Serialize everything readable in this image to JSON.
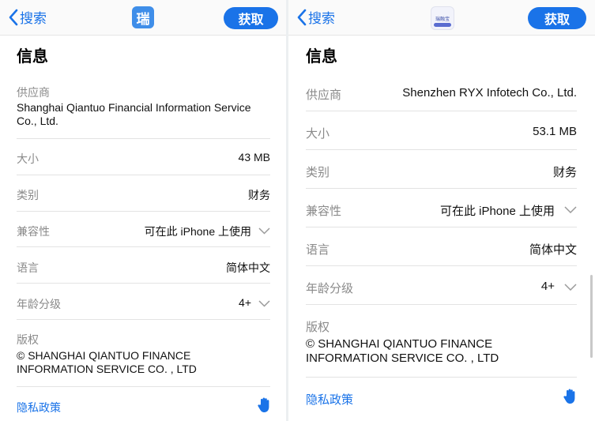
{
  "left": {
    "nav": {
      "back_label": "搜索",
      "icon_char": "瑞",
      "get_label": "获取"
    },
    "section_title": "信息",
    "vendor": {
      "label": "供应商",
      "value": "Shanghai Qiantuo Financial Information Service Co., Ltd."
    },
    "size": {
      "label": "大小",
      "value": "43 MB"
    },
    "category": {
      "label": "类别",
      "value": "财务"
    },
    "compatibility": {
      "label": "兼容性",
      "value": "可在此 iPhone 上使用"
    },
    "language": {
      "label": "语言",
      "value": "简体中文"
    },
    "age": {
      "label": "年龄分级",
      "value": "4+"
    },
    "copyright": {
      "label": "版权",
      "value": "© SHANGHAI QIANTUO FINANCE INFORMATION SERVICE CO. , LTD"
    },
    "privacy": {
      "label": "隐私政策"
    }
  },
  "right": {
    "nav": {
      "back_label": "搜索",
      "icon_text": "瑞融宝",
      "get_label": "获取"
    },
    "section_title": "信息",
    "vendor": {
      "label": "供应商",
      "value": "Shenzhen RYX Infotech Co., Ltd."
    },
    "size": {
      "label": "大小",
      "value": "53.1 MB"
    },
    "category": {
      "label": "类别",
      "value": "财务"
    },
    "compatibility": {
      "label": "兼容性",
      "value": "可在此 iPhone 上使用"
    },
    "language": {
      "label": "语言",
      "value": "简体中文"
    },
    "age": {
      "label": "年龄分级",
      "value": "4+"
    },
    "copyright": {
      "label": "版权",
      "value": "© SHANGHAI QIANTUO FINANCE INFORMATION SERVICE CO. , LTD"
    },
    "privacy": {
      "label": "隐私政策"
    }
  },
  "colors": {
    "accent": "#1a73e8",
    "label_gray": "#8a8a8a",
    "separator": "#e3e3e3"
  }
}
